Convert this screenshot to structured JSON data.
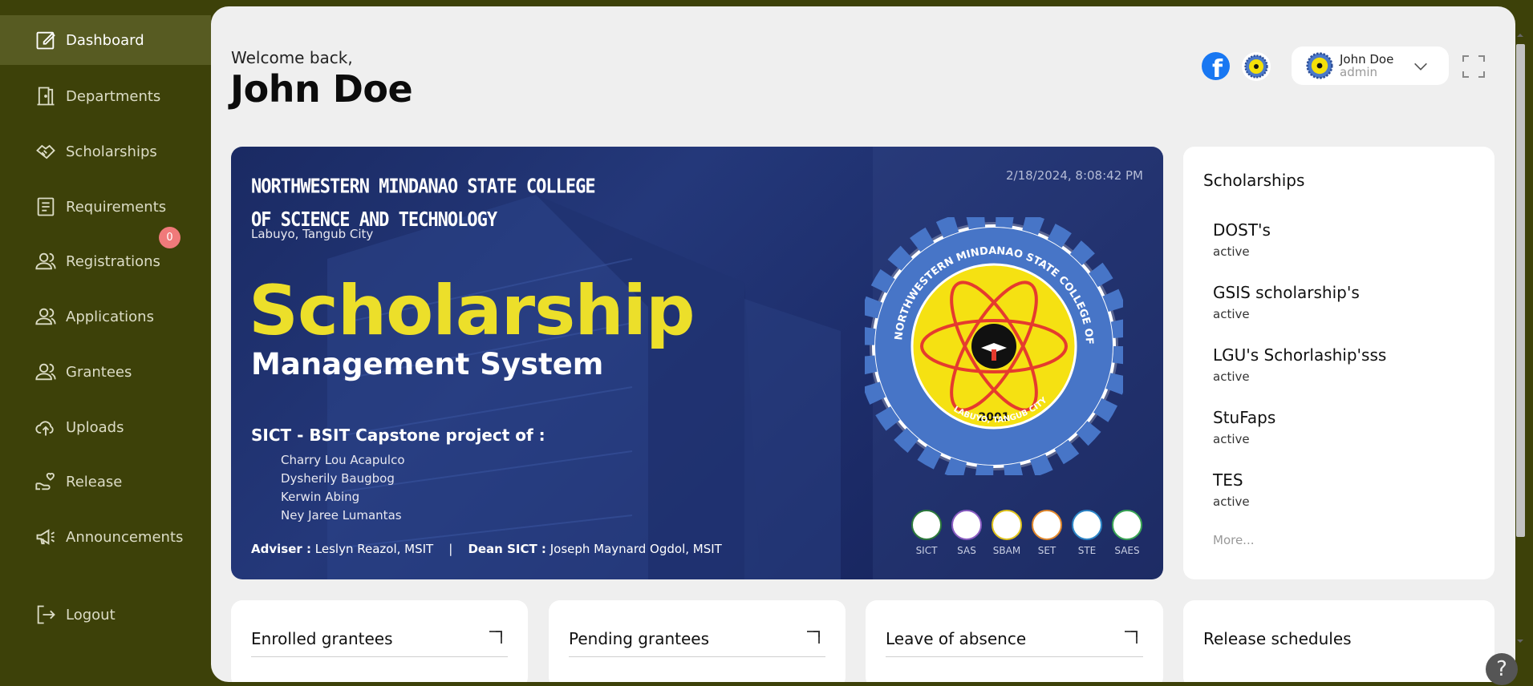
{
  "sidebar": {
    "items": [
      {
        "label": "Dashboard",
        "icon": "edit-icon",
        "active": true
      },
      {
        "label": "Departments",
        "icon": "door-icon"
      },
      {
        "label": "Scholarships",
        "icon": "handshake-icon"
      },
      {
        "label": "Requirements",
        "icon": "document-icon"
      },
      {
        "label": "Registrations",
        "icon": "users-icon",
        "badge": "0"
      },
      {
        "label": "Applications",
        "icon": "users-icon"
      },
      {
        "label": "Grantees",
        "icon": "users-icon"
      },
      {
        "label": "Uploads",
        "icon": "cloud-upload-icon"
      },
      {
        "label": "Release",
        "icon": "hand-heart-icon"
      },
      {
        "label": "Announcements",
        "icon": "megaphone-icon"
      }
    ],
    "logout": "Logout"
  },
  "header": {
    "welcome": "Welcome back,",
    "username": "John Doe",
    "user_chip": {
      "name": "John Doe",
      "role": "admin"
    }
  },
  "hero": {
    "college_line1": "NORTHWESTERN MINDANAO STATE COLLEGE",
    "college_line2": "OF SCIENCE AND TECHNOLOGY",
    "location": "Labuyo, Tangub City",
    "datetime": "2/18/2024, 8:08:42 PM",
    "title": "Scholarship",
    "subtitle": "Management System",
    "project": "SICT - BSIT Capstone project of :",
    "members": [
      "Charry Lou Acapulco",
      "Dysherily Baugbog",
      "Kerwin Abing",
      "Ney Jaree Lumantas"
    ],
    "adviser_label": "Adviser :",
    "adviser": "Leslyn Reazol, MSIT",
    "separator": "|",
    "dean_label": "Dean SICT :",
    "dean": "Joseph Maynard Ogdol, MSIT",
    "seal": {
      "ring_text": "NORTHWESTERN MINDANAO STATE COLLEGE OF SCIENCE AND TECHNOLOGY",
      "bottom_text": "LABUYO, TANGUB CITY",
      "year": "2001"
    },
    "departments": [
      "SICT",
      "SAS",
      "SBAM",
      "SET",
      "STE",
      "SAES"
    ]
  },
  "scholarships": {
    "title": "Scholarships",
    "items": [
      {
        "name": "DOST's",
        "status": "active"
      },
      {
        "name": "GSIS scholarship's",
        "status": "active"
      },
      {
        "name": "LGU's Schorlaship'sss",
        "status": "active"
      },
      {
        "name": "StuFaps",
        "status": "active"
      },
      {
        "name": "TES",
        "status": "active"
      }
    ],
    "more": "More..."
  },
  "stats": [
    {
      "label": "Enrolled grantees"
    },
    {
      "label": "Pending grantees"
    },
    {
      "label": "Leave of absence"
    },
    {
      "label": "Release schedules"
    }
  ],
  "help": "?",
  "colors": {
    "sidebar": "#3d4109",
    "active": "#575b22",
    "accent_yellow": "#ecdf2a",
    "hero_blue": "#1f3272",
    "badge": "#f07a7a"
  }
}
